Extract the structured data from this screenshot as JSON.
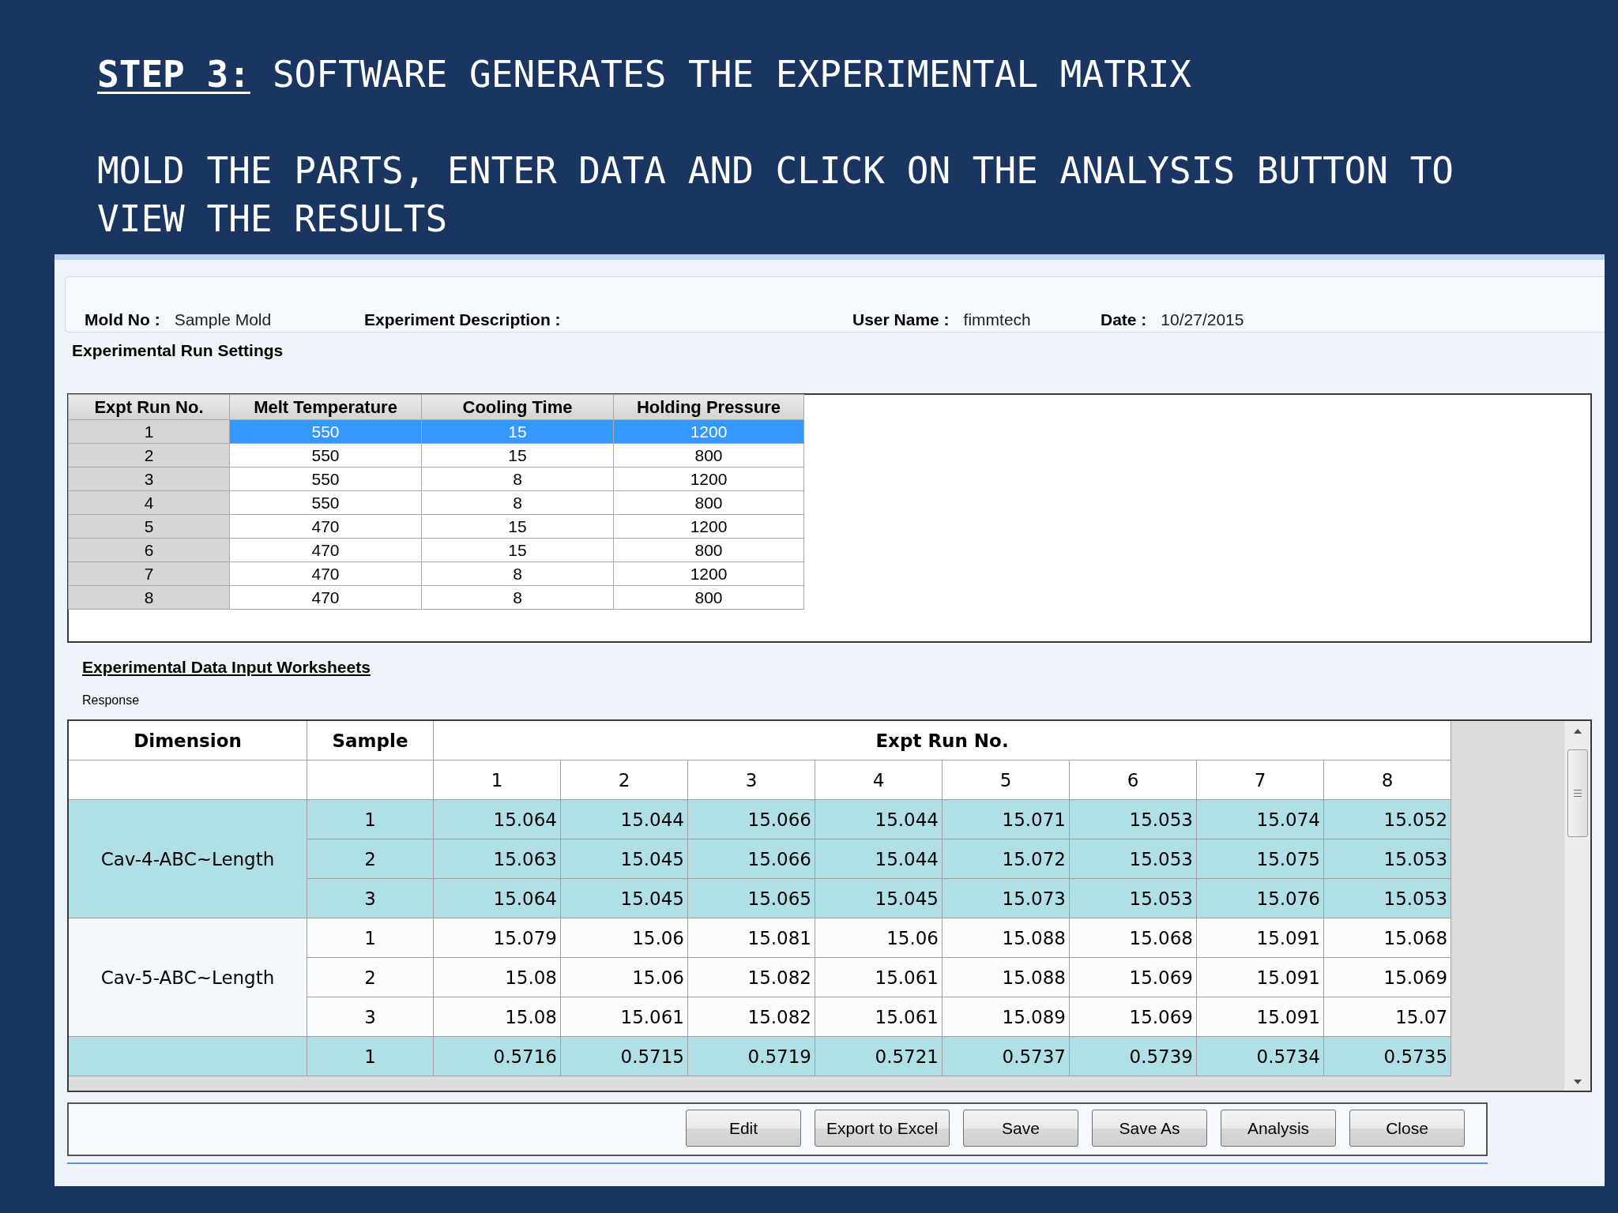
{
  "slide": {
    "step_label": "STEP 3:",
    "title": "SOFTWARE GENERATES THE EXPERIMENTAL MATRIX",
    "instruction": "MOLD THE PARTS, ENTER DATA AND CLICK ON THE ANALYSIS BUTTON TO VIEW THE RESULTS"
  },
  "window": {
    "info_fields": [
      {
        "label": "Mold No :",
        "value": "Sample Mold"
      },
      {
        "label": "Experiment Description :"
      },
      {
        "label": "User Name :",
        "value": "fimmtech"
      },
      {
        "label": "Date :",
        "value": "10/27/2015"
      }
    ],
    "run_settings": {
      "title": "Experimental Run Settings",
      "columns": [
        "Expt Run No.",
        "Melt Temperature",
        "Cooling Time",
        "Holding Pressure"
      ],
      "rows": [
        {
          "run": "1",
          "values": [
            "550",
            "15",
            "1200"
          ],
          "selected": true
        },
        {
          "run": "2",
          "values": [
            "550",
            "15",
            "800"
          ],
          "selected": false
        },
        {
          "run": "3",
          "values": [
            "550",
            "8",
            "1200"
          ],
          "selected": false
        },
        {
          "run": "4",
          "values": [
            "550",
            "8",
            "800"
          ],
          "selected": false
        },
        {
          "run": "5",
          "values": [
            "470",
            "15",
            "1200"
          ],
          "selected": false
        },
        {
          "run": "6",
          "values": [
            "470",
            "15",
            "800"
          ],
          "selected": false
        },
        {
          "run": "7",
          "values": [
            "470",
            "8",
            "1200"
          ],
          "selected": false
        },
        {
          "run": "8",
          "values": [
            "470",
            "8",
            "800"
          ],
          "selected": false
        }
      ]
    },
    "worksheets": {
      "title": "Experimental Data Input Worksheets",
      "response_label": "Response",
      "columns": {
        "dimension": "Dimension",
        "sample": "Sample",
        "runs_title": "Expt Run No.",
        "runs": [
          "1",
          "2",
          "3",
          "4",
          "5",
          "6",
          "7",
          "8"
        ]
      },
      "groups": [
        {
          "dimension": "Cav-4-ABC~Length",
          "rows": [
            {
              "sample": "1",
              "values": [
                "15.064",
                "15.044",
                "15.066",
                "15.044",
                "15.071",
                "15.053",
                "15.074",
                "15.052"
              ]
            },
            {
              "sample": "2",
              "values": [
                "15.063",
                "15.045",
                "15.066",
                "15.044",
                "15.072",
                "15.053",
                "15.075",
                "15.053"
              ]
            },
            {
              "sample": "3",
              "values": [
                "15.064",
                "15.045",
                "15.065",
                "15.045",
                "15.073",
                "15.053",
                "15.076",
                "15.053"
              ]
            }
          ]
        },
        {
          "dimension": "Cav-5-ABC~Length",
          "rows": [
            {
              "sample": "1",
              "values": [
                "15.079",
                "15.06",
                "15.081",
                "15.06",
                "15.088",
                "15.068",
                "15.091",
                "15.068"
              ]
            },
            {
              "sample": "2",
              "values": [
                "15.08",
                "15.06",
                "15.082",
                "15.061",
                "15.088",
                "15.069",
                "15.091",
                "15.069"
              ]
            },
            {
              "sample": "3",
              "values": [
                "15.08",
                "15.061",
                "15.082",
                "15.061",
                "15.089",
                "15.069",
                "15.091",
                "15.07"
              ]
            }
          ]
        },
        {
          "rows": [
            {
              "sample": "1",
              "values": [
                "0.5716",
                "0.5715",
                "0.5719",
                "0.5721",
                "0.5737",
                "0.5739",
                "0.5734",
                "0.5735"
              ]
            }
          ]
        }
      ]
    },
    "buttons": [
      "Edit",
      "Export to Excel",
      "Save",
      "Save As",
      "Analysis",
      "Close"
    ]
  }
}
